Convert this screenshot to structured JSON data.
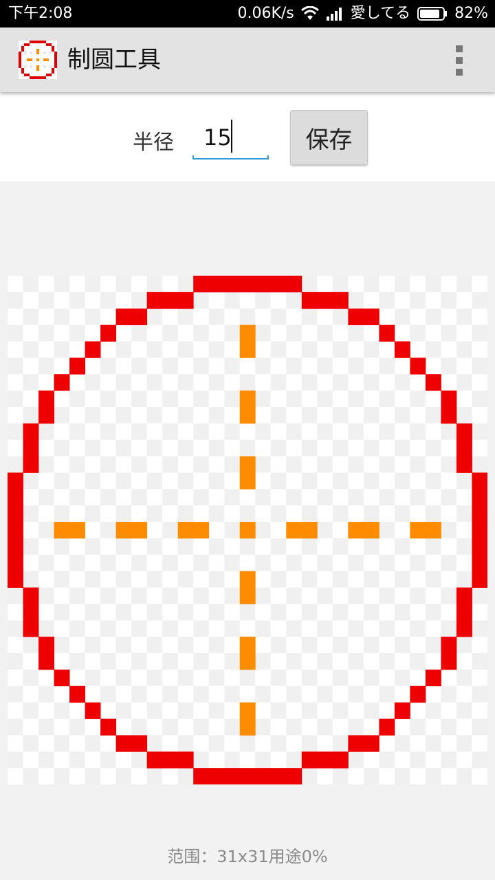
{
  "status_bar": {
    "time": "下午2:08",
    "speed": "0.06K/s",
    "carrier": "愛してる",
    "battery": "82%"
  },
  "app_bar": {
    "title": "制圆工具",
    "logo_icon": "pixel-circle-logo-icon",
    "overflow_icon": "overflow-menu-icon"
  },
  "controls": {
    "radius_label": "半径",
    "radius_value": "15",
    "save_label": "保存"
  },
  "canvas": {
    "grid_size": 31,
    "radius": 15,
    "colors": {
      "ring": "#ee0000",
      "crosshair": "#ff8c00",
      "checker_light": "#ffffff",
      "checker_dark": "#f0f0f0"
    }
  },
  "footer": {
    "info": "范围：31x31用途0%"
  }
}
